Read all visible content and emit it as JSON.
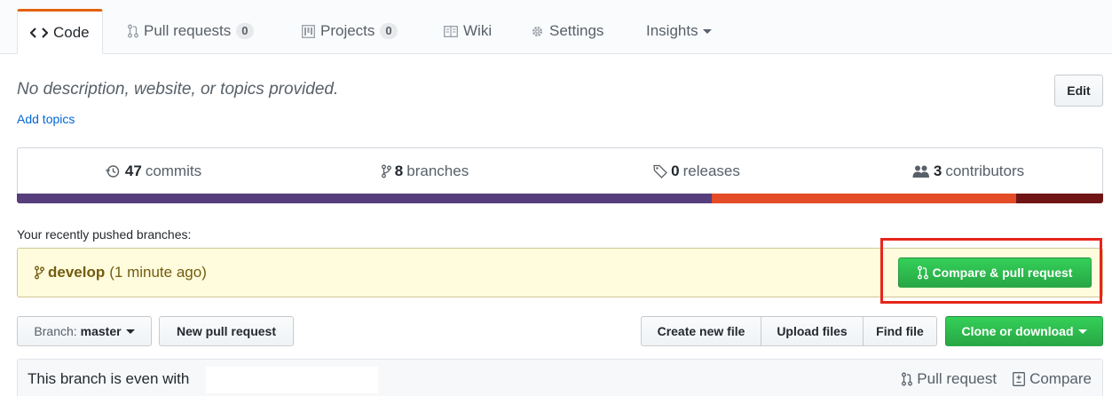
{
  "tabs": [
    {
      "label": "Code",
      "icon": "code-icon",
      "counter": null,
      "selected": true
    },
    {
      "label": "Pull requests",
      "icon": "pull-request-icon",
      "counter": "0"
    },
    {
      "label": "Projects",
      "icon": "project-icon",
      "counter": "0"
    },
    {
      "label": "Wiki",
      "icon": "book-icon",
      "counter": null
    },
    {
      "label": "Settings",
      "icon": "gear-icon",
      "counter": null
    },
    {
      "label": "Insights",
      "icon": null,
      "counter": null
    }
  ],
  "repo": {
    "description": "No description, website, or topics provided.",
    "add_topics": "Add topics",
    "edit_label": "Edit"
  },
  "summary": {
    "commits_count": "47",
    "commits_label": "commits",
    "branches_count": "8",
    "branches_label": "branches",
    "releases_count": "0",
    "releases_label": "releases",
    "contributors_count": "3",
    "contributors_label": "contributors"
  },
  "language_bar": [
    {
      "color": "#563d7c",
      "fraction": 0.64
    },
    {
      "color": "#e34c26",
      "fraction": 0.28
    },
    {
      "color": "#701516",
      "fraction": 0.08
    }
  ],
  "recent": {
    "label": "Your recently pushed branches:",
    "branch": "develop",
    "time": "(1 minute ago)",
    "compare_label": "Compare & pull request"
  },
  "file_nav": {
    "branch_prefix": "Branch:",
    "branch_name": "master",
    "new_pr": "New pull request",
    "create_file": "Create new file",
    "upload_files": "Upload files",
    "find_file": "Find file",
    "clone": "Clone or download"
  },
  "status": {
    "text": "This branch is even with",
    "pull_request": "Pull request",
    "compare": "Compare"
  },
  "colors": {
    "accent_tab": "#e36209",
    "green": "#28a745",
    "highlight": "#e8251a",
    "link": "#0366d6"
  }
}
